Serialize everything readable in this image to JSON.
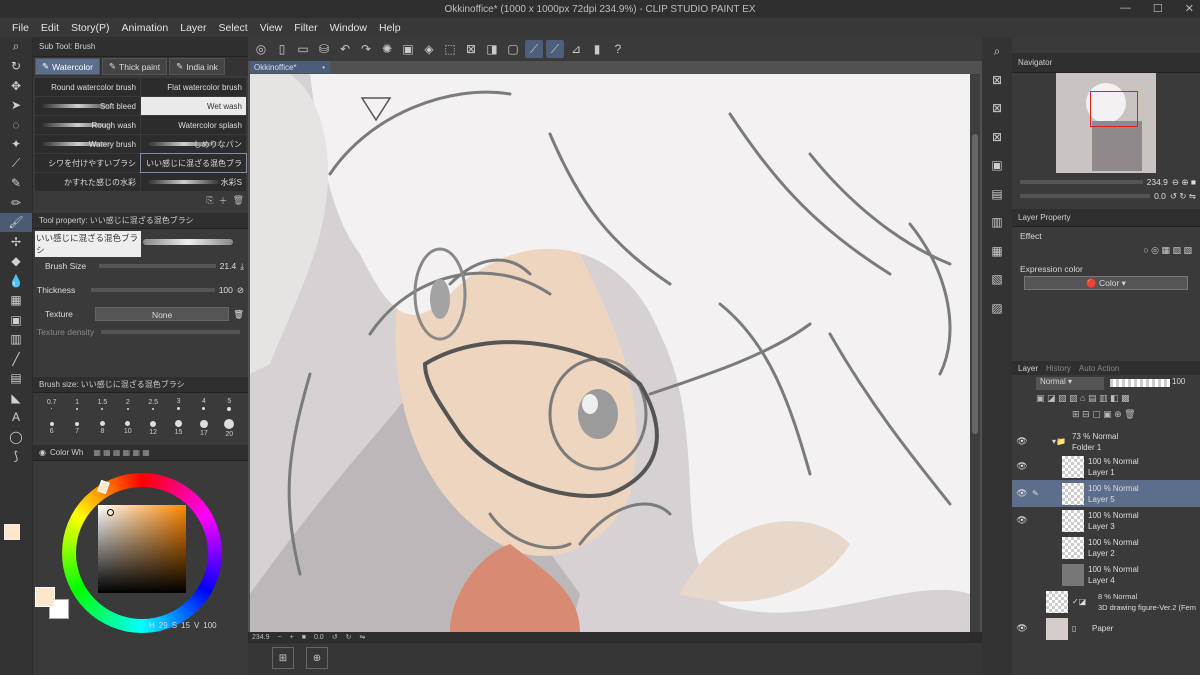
{
  "titlebar": {
    "title": "Okkinoffice* (1000 x 1000px 72dpi 234.9%)  - CLIP STUDIO PAINT EX"
  },
  "menu": [
    "File",
    "Edit",
    "Story(P)",
    "Animation",
    "Layer",
    "Select",
    "View",
    "Filter",
    "Window",
    "Help"
  ],
  "subtool": {
    "header": "Sub Tool: Brush",
    "tabs": [
      "Watercolor",
      "Thick paint",
      "India ink"
    ],
    "brushes": [
      {
        "name": "Round watercolor brush"
      },
      {
        "name": "Flat watercolor brush"
      },
      {
        "name": "Soft bleed"
      },
      {
        "name": "Wet wash"
      },
      {
        "name": "Rough wash"
      },
      {
        "name": "Watercolor splash"
      },
      {
        "name": "Watery brush"
      },
      {
        "name": "しめりなパン"
      },
      {
        "name": "シワを付けやすいブラシ"
      },
      {
        "name": "いい感じに混ざる混色ブラ"
      },
      {
        "name": "かすれた感じの水彩"
      },
      {
        "name": "水彩S"
      }
    ]
  },
  "toolprop": {
    "header": "Tool property: いい感じに混ざる混色ブラシ",
    "preset": "いい感じに混ざる混色ブラシ",
    "brush_size_label": "Brush Size",
    "brush_size": "21.4",
    "thickness_label": "Thickness",
    "thickness": "100",
    "texture_label": "Texture",
    "texture_value": "None",
    "density_label": "Texture density"
  },
  "brushsize": {
    "header": "Brush size: いい感じに混ざる混色ブラシ",
    "row1": [
      "0.7",
      "1",
      "1.5",
      "2",
      "2.5",
      "3",
      "4",
      "5"
    ],
    "row2": [
      "6",
      "7",
      "8",
      "10",
      "12",
      "15",
      "17",
      "20"
    ]
  },
  "color": {
    "header": "Color Wh",
    "h": "29",
    "s": "15",
    "v": "100",
    "main": "#fde6cc"
  },
  "canvas": {
    "tab": "Okkinoffice*",
    "zoom": "234.9",
    "angle": "0.0"
  },
  "navigator": {
    "header": "Navigator",
    "zoom": "234.9",
    "angle": "0.0"
  },
  "layerprop": {
    "header": "Layer Property",
    "effect_label": "Effect",
    "expr_label": "Expression color",
    "expr_value": "Color"
  },
  "layers": {
    "tabs": [
      "Layer",
      "History",
      "Auto Action"
    ],
    "blend": "Normal",
    "opacity": "100",
    "items": [
      {
        "mode": "73 % Normal",
        "name": "Folder 1"
      },
      {
        "mode": "100 % Normal",
        "name": "Layer 1"
      },
      {
        "mode": "100 % Normal",
        "name": "Layer 5"
      },
      {
        "mode": "100 % Normal",
        "name": "Layer 3"
      },
      {
        "mode": "100 % Normal",
        "name": "Layer 2"
      },
      {
        "mode": "100 % Normal",
        "name": "Layer 4"
      },
      {
        "mode": "8 % Normal",
        "name": "3D drawing figure-Ver.2 (Fem"
      },
      {
        "mode": "",
        "name": "Paper"
      }
    ]
  }
}
